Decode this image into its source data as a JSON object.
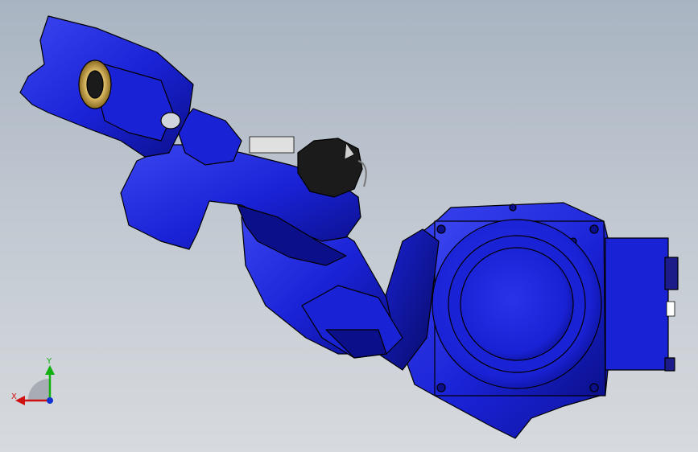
{
  "viewport": {
    "name": "3d-cad-viewport",
    "model": "industrial-robot-arm",
    "colors": {
      "background_top": "#a9b4c2",
      "background_bottom": "#d7dade",
      "body_blue": "#1a22d6",
      "body_blue_dark": "#0b108a",
      "body_blue_light": "#3b46f0",
      "outline": "#000000",
      "bearing_gold": "#c9a24a",
      "motor_black": "#1b1b1b"
    }
  },
  "triad": {
    "x_label": "X",
    "y_label": "Y",
    "colors": {
      "x": "#d01010",
      "y": "#10b010",
      "z": "#1030d0"
    }
  }
}
